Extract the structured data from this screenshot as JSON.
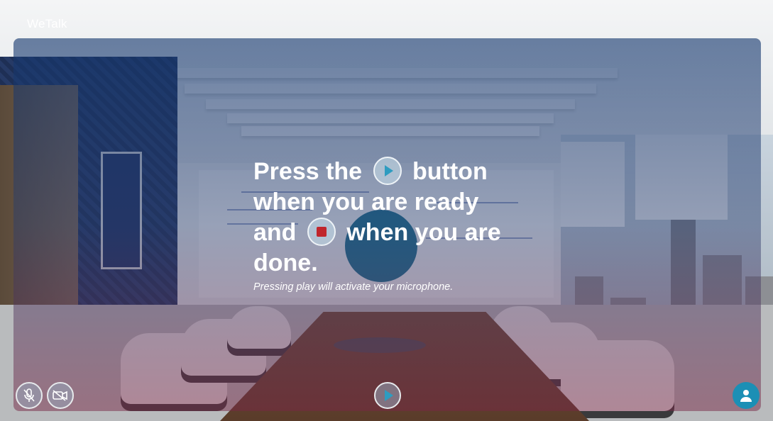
{
  "app": {
    "brand": "WeTalk"
  },
  "prompt": {
    "line1_before": "Press the",
    "line1_after": "button",
    "line2": "when you are ready",
    "line3_before": "and",
    "line3_after": "when you are",
    "line4": "done.",
    "subtitle": "Pressing play will activate your microphone."
  },
  "controls": {
    "mic": {
      "icon": "mic-muted-icon"
    },
    "camera": {
      "icon": "camera-off-icon"
    },
    "play": {
      "icon": "play-icon"
    },
    "profile": {
      "icon": "user-icon"
    }
  },
  "colors": {
    "accent": "#2e9cc0",
    "stop": "#c0262c",
    "profile": "#1c8fb5"
  }
}
